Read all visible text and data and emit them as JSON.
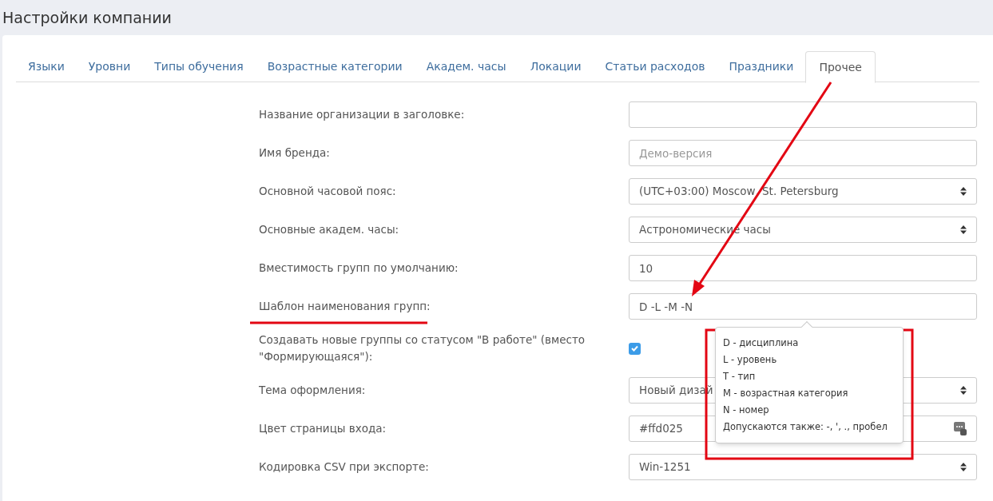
{
  "page": {
    "title": "Настройки компании"
  },
  "tabs": [
    {
      "label": "Языки",
      "selected": false
    },
    {
      "label": "Уровни",
      "selected": false
    },
    {
      "label": "Типы обучения",
      "selected": false
    },
    {
      "label": "Возрастные категории",
      "selected": false
    },
    {
      "label": "Академ. часы",
      "selected": false
    },
    {
      "label": "Локации",
      "selected": false
    },
    {
      "label": "Статьи расходов",
      "selected": false
    },
    {
      "label": "Праздники",
      "selected": false
    },
    {
      "label": "Прочее",
      "selected": true
    }
  ],
  "fields": [
    {
      "kind": "input",
      "label": "Название организации в заголовке:"
    },
    {
      "kind": "input",
      "label": "Имя бренда:",
      "placeholder": "Демо-версия"
    },
    {
      "kind": "select",
      "label": "Основной часовой пояс:",
      "value": "(UTC+03:00) Moscow, St. Petersburg"
    },
    {
      "kind": "select",
      "label": "Основные академ. часы:",
      "value": "Астрономические часы"
    },
    {
      "kind": "input",
      "label": "Вместимость групп по умолчанию:",
      "value": "10"
    },
    {
      "kind": "input",
      "label": "Шаблон наименования групп:",
      "value": "D -L -M -N",
      "tooltip": [
        "D - дисциплина",
        "L - уровень",
        "T - тип",
        "M - возрастная категория",
        "N - номер",
        "Допускаются также: -, ', ., пробел"
      ]
    },
    {
      "kind": "checkbox",
      "label": "Создавать новые группы со статусом \"В работе\" (вместо \"Формирующаяся\"):",
      "checked": true
    },
    {
      "kind": "select",
      "label": "Тема оформления:",
      "value": "Новый дизай"
    },
    {
      "kind": "color",
      "label": "Цвет страницы входа:",
      "value": "#ffd025"
    },
    {
      "kind": "select",
      "label": "Кодировка CSV при экспорте:",
      "value": "Win-1251"
    }
  ]
}
